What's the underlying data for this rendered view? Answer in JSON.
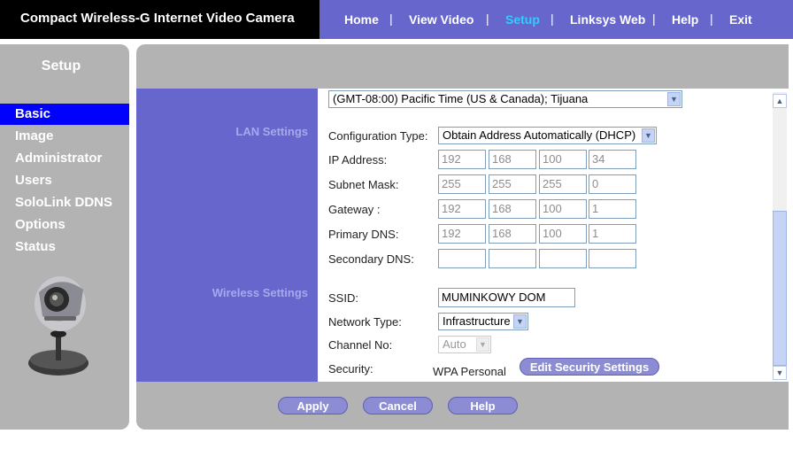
{
  "app": {
    "title": "Compact Wireless-G Internet Video Camera"
  },
  "topnav": {
    "items": [
      "Home",
      "View Video",
      "Setup",
      "Linksys Web",
      "Help",
      "Exit"
    ],
    "separator": "|",
    "active": "Setup"
  },
  "sidebar": {
    "title": "Setup",
    "items": [
      "Basic",
      "Image",
      "Administrator",
      "Users",
      "SoloLink DDNS",
      "Options",
      "Status"
    ],
    "active": "Basic"
  },
  "form": {
    "timezone": "(GMT-08:00) Pacific Time (US & Canada); Tijuana",
    "lan": {
      "section_label": "LAN Settings",
      "config_type_label": "Configuration Type:",
      "config_type_value": "Obtain Address Automatically (DHCP)",
      "ip_label": "IP Address:",
      "ip": [
        "192",
        "168",
        "100",
        "34"
      ],
      "subnet_label": "Subnet Mask:",
      "subnet": [
        "255",
        "255",
        "255",
        "0"
      ],
      "gateway_label": "Gateway :",
      "gateway": [
        "192",
        "168",
        "100",
        "1"
      ],
      "dns1_label": "Primary DNS:",
      "dns1": [
        "192",
        "168",
        "100",
        "1"
      ],
      "dns2_label": "Secondary DNS:",
      "dns2": [
        "",
        "",
        "",
        ""
      ]
    },
    "wireless": {
      "section_label": "Wireless Settings",
      "ssid_label": "SSID:",
      "ssid": "MUMINKOWY DOM",
      "network_type_label": "Network Type:",
      "network_type": "Infrastructure",
      "channel_label": "Channel No:",
      "channel": "Auto",
      "security_label": "Security:",
      "security_value": "WPA Personal",
      "edit_security_label": "Edit Security Settings"
    }
  },
  "buttons": {
    "apply": "Apply",
    "cancel": "Cancel",
    "help": "Help"
  },
  "colors": {
    "accent": "#6666cc",
    "active_sidebar": "#0000ff",
    "active_nav": "#33ccff",
    "panel_gray": "#b3b3b3"
  },
  "icons": {
    "scroll_up": "up-arrow-icon",
    "scroll_down": "down-arrow-icon",
    "dropdown": "chevron-down-icon",
    "camera": "camera-image"
  }
}
